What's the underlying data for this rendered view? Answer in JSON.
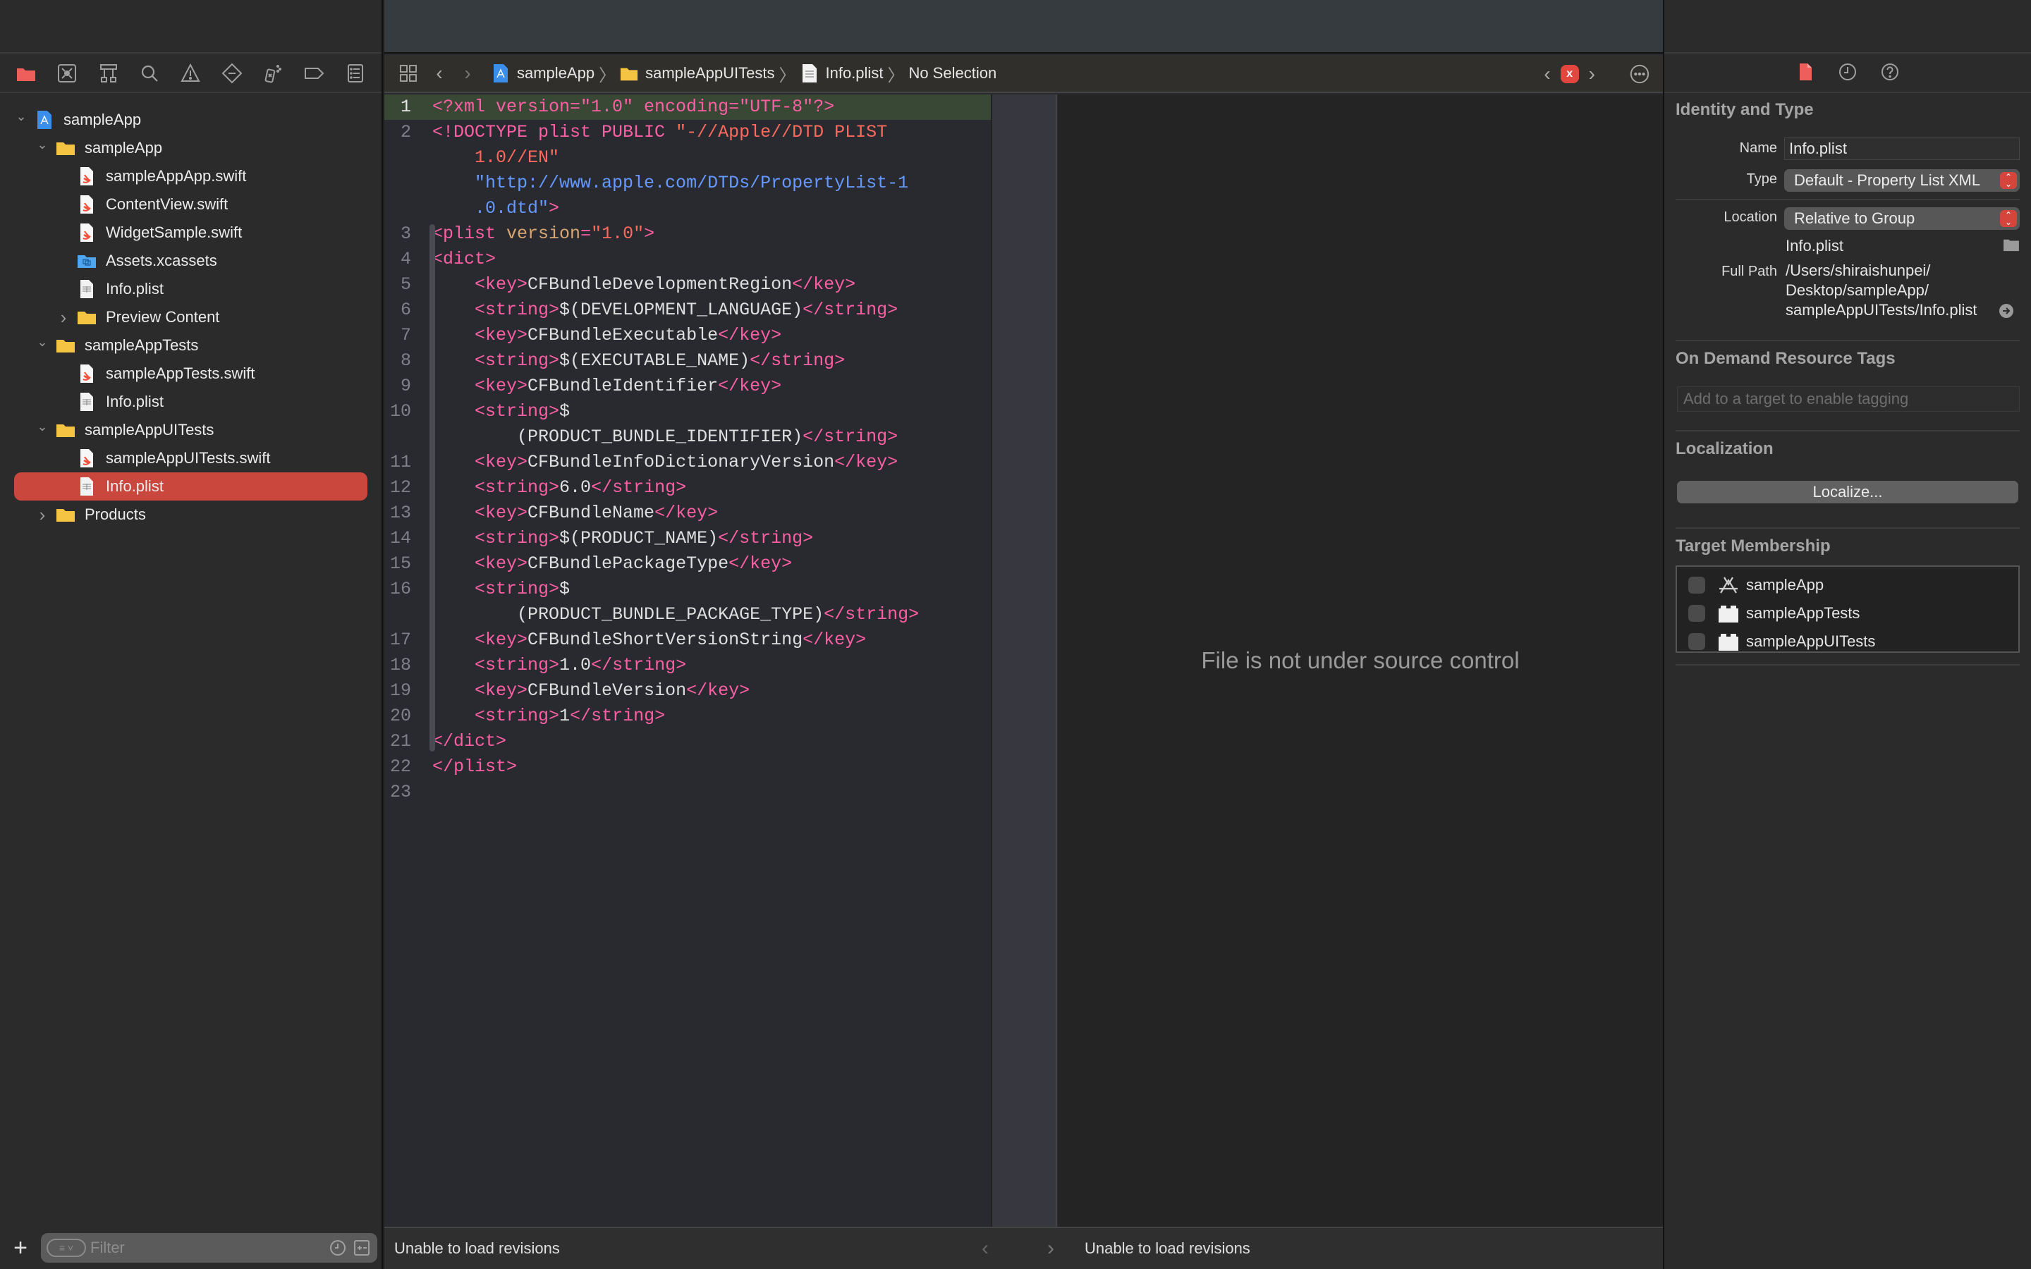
{
  "navigator": {
    "tab_icons": [
      "project-navigator-icon",
      "source-control-icon",
      "symbol-navigator-icon",
      "find-icon",
      "issue-icon",
      "test-icon",
      "debug-icon",
      "breakpoint-icon",
      "report-icon"
    ],
    "tree": [
      {
        "label": "sampleApp",
        "type": "project",
        "depth": 0,
        "expanded": true
      },
      {
        "label": "sampleApp",
        "type": "folder",
        "depth": 1,
        "expanded": true
      },
      {
        "label": "sampleAppApp.swift",
        "type": "swift",
        "depth": 2
      },
      {
        "label": "ContentView.swift",
        "type": "swift",
        "depth": 2
      },
      {
        "label": "WidgetSample.swift",
        "type": "swift",
        "depth": 2
      },
      {
        "label": "Assets.xcassets",
        "type": "assets",
        "depth": 2
      },
      {
        "label": "Info.plist",
        "type": "plist",
        "depth": 2
      },
      {
        "label": "Preview Content",
        "type": "folder",
        "depth": 2,
        "expanded": false
      },
      {
        "label": "sampleAppTests",
        "type": "folder",
        "depth": 1,
        "expanded": true
      },
      {
        "label": "sampleAppTests.swift",
        "type": "swift",
        "depth": 2
      },
      {
        "label": "Info.plist",
        "type": "plist",
        "depth": 2
      },
      {
        "label": "sampleAppUITests",
        "type": "folder",
        "depth": 1,
        "expanded": true
      },
      {
        "label": "sampleAppUITests.swift",
        "type": "swift",
        "depth": 2
      },
      {
        "label": "Info.plist",
        "type": "plist",
        "depth": 2,
        "selected": true
      },
      {
        "label": "Products",
        "type": "folder",
        "depth": 1,
        "expanded": false
      }
    ],
    "filter_placeholder": "Filter",
    "add_label": "+"
  },
  "jumpbar": {
    "crumbs": [
      {
        "label": "sampleApp",
        "icon": "project-file-icon"
      },
      {
        "label": "sampleAppUITests",
        "icon": "folder-icon"
      },
      {
        "label": "Info.plist",
        "icon": "plist-file-icon"
      },
      {
        "label": "No Selection",
        "icon": null
      }
    ],
    "error_badge": "x"
  },
  "code": {
    "current_line": 1,
    "lines": [
      {
        "n": "1",
        "segs": [
          [
            "tag",
            "<?xml version=\"1.0\" encoding=\"UTF-8\"?>"
          ]
        ]
      },
      {
        "n": "2",
        "segs": [
          [
            "tag",
            "<!DOCTYPE plist PUBLIC "
          ],
          [
            "str",
            "\"-//Apple//DTD PLIST"
          ]
        ]
      },
      {
        "n": "",
        "segs": [
          [
            "str",
            "    1.0//EN\""
          ]
        ]
      },
      {
        "n": "",
        "segs": [
          [
            "url",
            "    \"http://www.apple.com/DTDs/PropertyList-1"
          ]
        ]
      },
      {
        "n": "",
        "segs": [
          [
            "url",
            "    .0.dtd\""
          ],
          [
            "tag",
            ">"
          ]
        ]
      },
      {
        "n": "3",
        "segs": [
          [
            "tag",
            "<plist "
          ],
          [
            "attr",
            "version"
          ],
          [
            "tag",
            "="
          ],
          [
            "str",
            "\"1.0\""
          ],
          [
            "tag",
            ">"
          ]
        ]
      },
      {
        "n": "4",
        "segs": [
          [
            "tag",
            "<dict>"
          ]
        ]
      },
      {
        "n": "5",
        "segs": [
          [
            "tag",
            "    <key>"
          ],
          [
            "plain",
            "CFBundleDevelopmentRegion"
          ],
          [
            "tag",
            "</key>"
          ]
        ]
      },
      {
        "n": "6",
        "segs": [
          [
            "tag",
            "    <string>"
          ],
          [
            "plain",
            "$(DEVELOPMENT_LANGUAGE)"
          ],
          [
            "tag",
            "</string>"
          ]
        ]
      },
      {
        "n": "7",
        "segs": [
          [
            "tag",
            "    <key>"
          ],
          [
            "plain",
            "CFBundleExecutable"
          ],
          [
            "tag",
            "</key>"
          ]
        ]
      },
      {
        "n": "8",
        "segs": [
          [
            "tag",
            "    <string>"
          ],
          [
            "plain",
            "$(EXECUTABLE_NAME)"
          ],
          [
            "tag",
            "</string>"
          ]
        ]
      },
      {
        "n": "9",
        "segs": [
          [
            "tag",
            "    <key>"
          ],
          [
            "plain",
            "CFBundleIdentifier"
          ],
          [
            "tag",
            "</key>"
          ]
        ]
      },
      {
        "n": "10",
        "segs": [
          [
            "tag",
            "    <string>"
          ],
          [
            "plain",
            "$"
          ]
        ]
      },
      {
        "n": "",
        "segs": [
          [
            "plain",
            "        (PRODUCT_BUNDLE_IDENTIFIER)"
          ],
          [
            "tag",
            "</string>"
          ]
        ]
      },
      {
        "n": "11",
        "segs": [
          [
            "tag",
            "    <key>"
          ],
          [
            "plain",
            "CFBundleInfoDictionaryVersion"
          ],
          [
            "tag",
            "</key>"
          ]
        ]
      },
      {
        "n": "12",
        "segs": [
          [
            "tag",
            "    <string>"
          ],
          [
            "plain",
            "6.0"
          ],
          [
            "tag",
            "</string>"
          ]
        ]
      },
      {
        "n": "13",
        "segs": [
          [
            "tag",
            "    <key>"
          ],
          [
            "plain",
            "CFBundleName"
          ],
          [
            "tag",
            "</key>"
          ]
        ]
      },
      {
        "n": "14",
        "segs": [
          [
            "tag",
            "    <string>"
          ],
          [
            "plain",
            "$(PRODUCT_NAME)"
          ],
          [
            "tag",
            "</string>"
          ]
        ]
      },
      {
        "n": "15",
        "segs": [
          [
            "tag",
            "    <key>"
          ],
          [
            "plain",
            "CFBundlePackageType"
          ],
          [
            "tag",
            "</key>"
          ]
        ]
      },
      {
        "n": "16",
        "segs": [
          [
            "tag",
            "    <string>"
          ],
          [
            "plain",
            "$"
          ]
        ]
      },
      {
        "n": "",
        "segs": [
          [
            "plain",
            "        (PRODUCT_BUNDLE_PACKAGE_TYPE)"
          ],
          [
            "tag",
            "</string>"
          ]
        ]
      },
      {
        "n": "17",
        "segs": [
          [
            "tag",
            "    <key>"
          ],
          [
            "plain",
            "CFBundleShortVersionString"
          ],
          [
            "tag",
            "</key>"
          ]
        ]
      },
      {
        "n": "18",
        "segs": [
          [
            "tag",
            "    <string>"
          ],
          [
            "plain",
            "1.0"
          ],
          [
            "tag",
            "</string>"
          ]
        ]
      },
      {
        "n": "19",
        "segs": [
          [
            "tag",
            "    <key>"
          ],
          [
            "plain",
            "CFBundleVersion"
          ],
          [
            "tag",
            "</key>"
          ]
        ]
      },
      {
        "n": "20",
        "segs": [
          [
            "tag",
            "    <string>"
          ],
          [
            "plain",
            "1"
          ],
          [
            "tag",
            "</string>"
          ]
        ]
      },
      {
        "n": "21",
        "segs": [
          [
            "tag",
            "</dict>"
          ]
        ]
      },
      {
        "n": "22",
        "segs": [
          [
            "tag",
            "</plist>"
          ]
        ]
      },
      {
        "n": "23",
        "segs": []
      }
    ]
  },
  "compare": {
    "message": "File is not under source control"
  },
  "bottom_bar": {
    "left_status": "Unable to load revisions",
    "right_status": "Unable to load revisions"
  },
  "inspector": {
    "tabs": [
      "file-inspector-icon",
      "history-inspector-icon",
      "quick-help-icon"
    ],
    "identity": {
      "title": "Identity and Type",
      "name_label": "Name",
      "name_value": "Info.plist",
      "type_label": "Type",
      "type_value": "Default - Property List XML",
      "location_label": "Location",
      "location_value": "Relative to Group",
      "location_file": "Info.plist",
      "full_path_label": "Full Path",
      "full_path_lines": [
        "/Users/shiraishunpei/",
        "Desktop/sampleApp/",
        "sampleAppUITests/Info.plist"
      ]
    },
    "odr": {
      "title": "On Demand Resource Tags",
      "placeholder": "Add to a target to enable tagging"
    },
    "localization": {
      "title": "Localization",
      "button": "Localize..."
    },
    "target_membership": {
      "title": "Target Membership",
      "targets": [
        {
          "name": "sampleApp",
          "icon": "app-target-icon",
          "checked": false
        },
        {
          "name": "sampleAppTests",
          "icon": "test-bundle-icon",
          "checked": false
        },
        {
          "name": "sampleAppUITests",
          "icon": "test-bundle-icon",
          "checked": false
        }
      ]
    }
  },
  "colors": {
    "accent": "#e65c55",
    "selection": "#c9473d",
    "current_line": "#384835",
    "xml_tag": "#fc5fa3",
    "xml_string": "#fc6a5d",
    "xml_url": "#6699ff",
    "xml_attr": "#d9a770"
  }
}
